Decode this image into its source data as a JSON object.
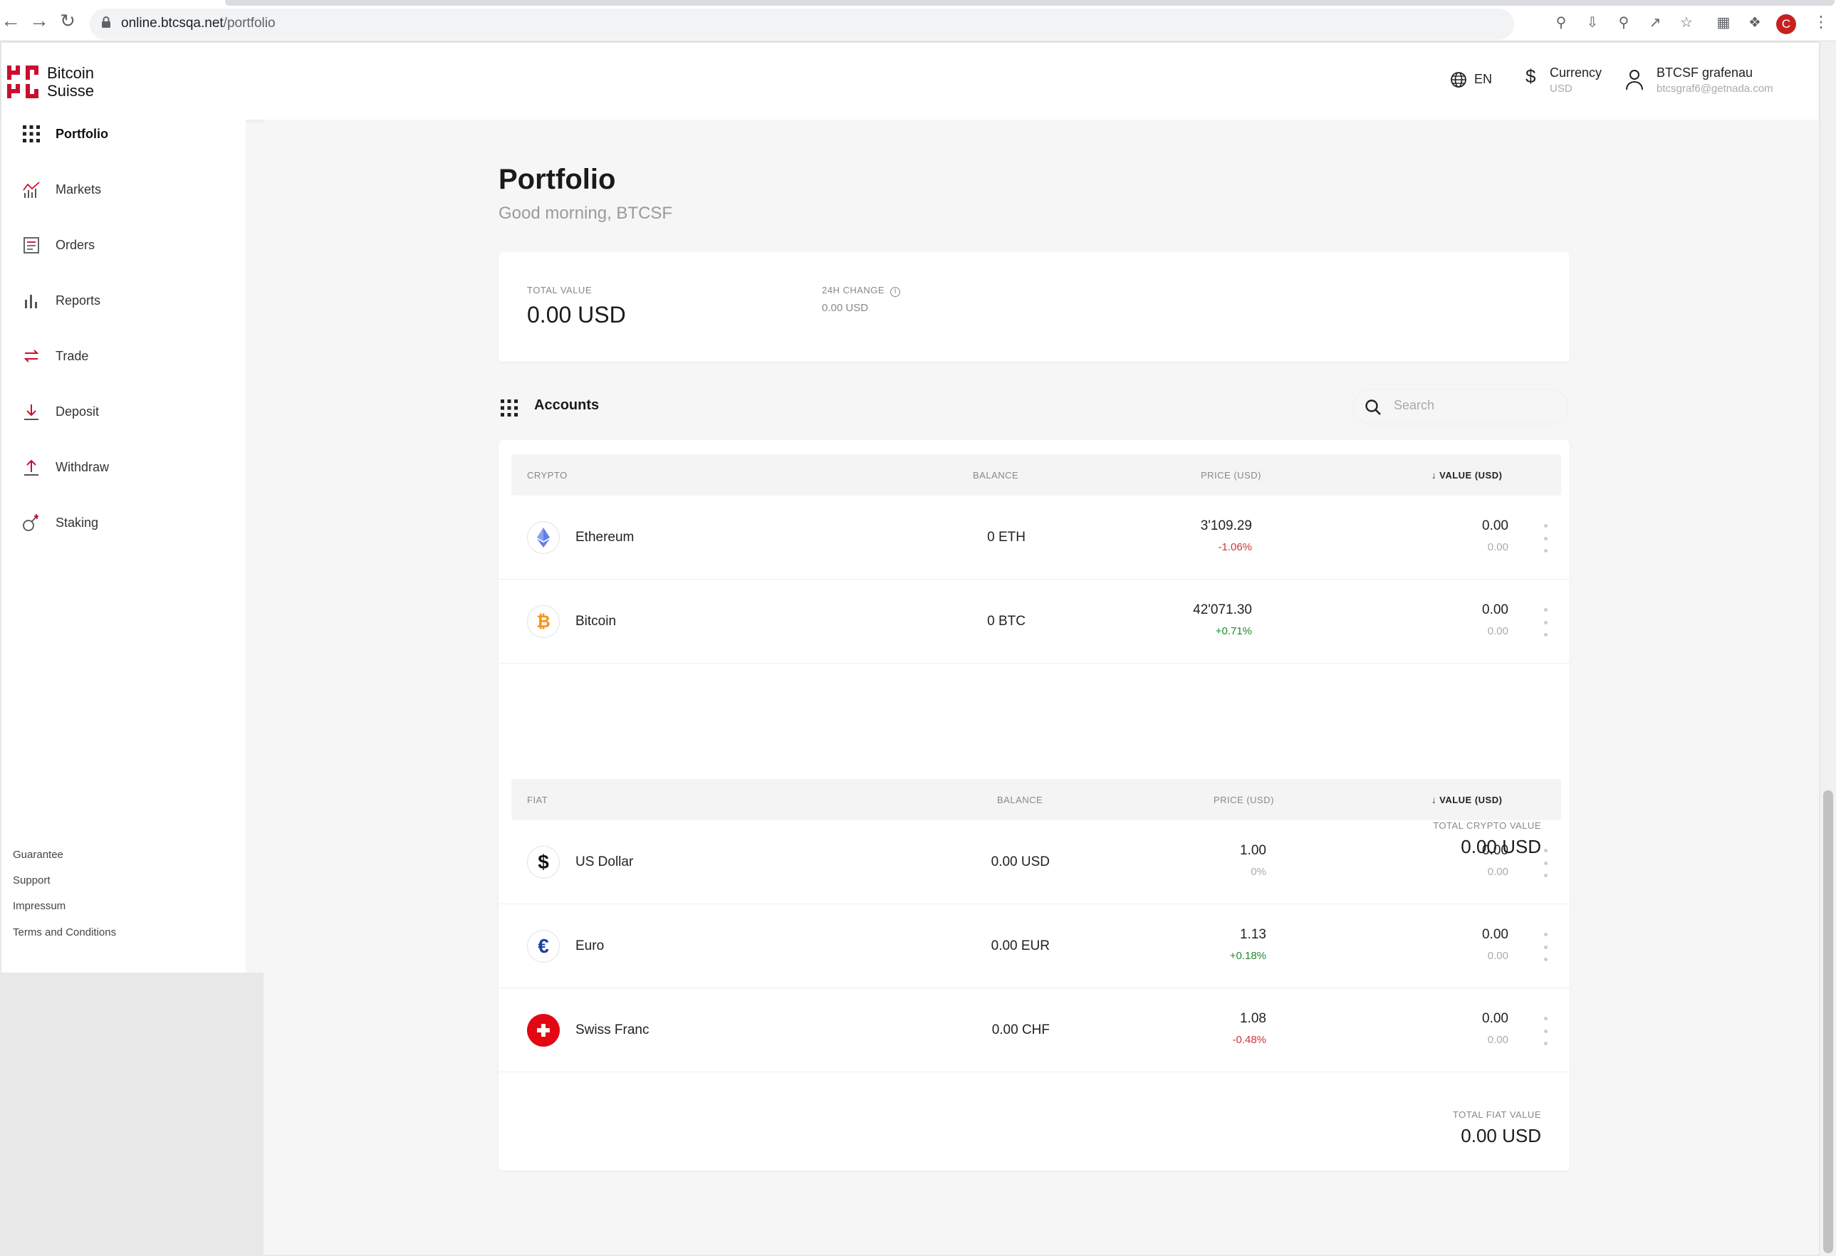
{
  "browser": {
    "url_domain": "online.btcsqa.net",
    "url_path": "/portfolio",
    "profile_initial": "C"
  },
  "brand": {
    "line1": "Bitcoin",
    "line2": "Suisse",
    "color": "#c8102e"
  },
  "header": {
    "language": "EN",
    "currency_label": "Currency",
    "currency_value": "USD",
    "user_name": "BTCSF grafenau",
    "user_email": "btcsgraf6@getnada.com"
  },
  "sidebar": {
    "items": [
      {
        "label": "Portfolio",
        "icon": "grid-icon",
        "active": true
      },
      {
        "label": "Markets",
        "icon": "chart-icon"
      },
      {
        "label": "Orders",
        "icon": "orders-icon"
      },
      {
        "label": "Reports",
        "icon": "bars-icon"
      },
      {
        "label": "Trade",
        "icon": "swap-icon"
      },
      {
        "label": "Deposit",
        "icon": "download-icon"
      },
      {
        "label": "Withdraw",
        "icon": "upload-icon"
      },
      {
        "label": "Staking",
        "icon": "staking-icon"
      }
    ],
    "footer": [
      "Guarantee",
      "Support",
      "Impressum",
      "Terms and Conditions"
    ]
  },
  "page": {
    "title": "Portfolio",
    "greeting": "Good morning, BTCSF"
  },
  "summary": {
    "total_value_label": "TOTAL VALUE",
    "total_value": "0.00 USD",
    "change_label": "24H CHANGE",
    "change_value": "0.00 USD"
  },
  "accounts": {
    "title": "Accounts",
    "search_placeholder": "Search",
    "crypto": {
      "headers": {
        "name": "CRYPTO",
        "balance": "BALANCE",
        "price": "PRICE (USD)",
        "value": "VALUE (USD)"
      },
      "rows": [
        {
          "name": "Ethereum",
          "balance": "0 ETH",
          "price": "3'109.29",
          "change": "-1.06%",
          "trend": "neg",
          "value": "0.00",
          "value_sub": "0.00"
        },
        {
          "name": "Bitcoin",
          "balance": "0 BTC",
          "price": "42'071.30",
          "change": "+0.71%",
          "trend": "pos",
          "value": "0.00",
          "value_sub": "0.00"
        }
      ],
      "total_label": "TOTAL CRYPTO VALUE",
      "total_value": "0.00 USD"
    },
    "fiat": {
      "headers": {
        "name": "FIAT",
        "balance": "BALANCE",
        "price": "PRICE (USD)",
        "value": "VALUE (USD)"
      },
      "rows": [
        {
          "name": "US Dollar",
          "balance": "0.00 USD",
          "price": "1.00",
          "change": "0%",
          "trend": "muted",
          "value": "0.00",
          "value_sub": "0.00"
        },
        {
          "name": "Euro",
          "balance": "0.00 EUR",
          "price": "1.13",
          "change": "+0.18%",
          "trend": "pos",
          "value": "0.00",
          "value_sub": "0.00"
        },
        {
          "name": "Swiss Franc",
          "balance": "0.00 CHF",
          "price": "1.08",
          "change": "-0.48%",
          "trend": "neg",
          "value": "0.00",
          "value_sub": "0.00"
        }
      ],
      "total_label": "TOTAL FIAT VALUE",
      "total_value": "0.00 USD"
    }
  }
}
